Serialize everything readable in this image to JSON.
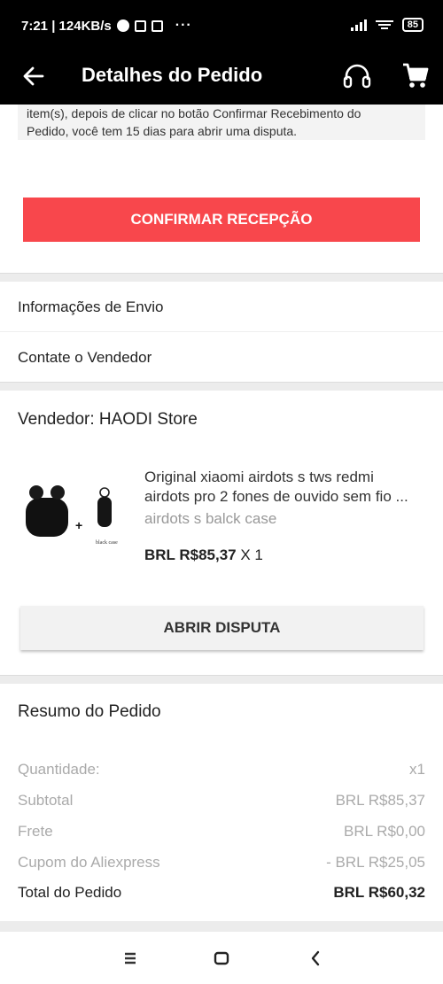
{
  "status_bar": {
    "time_speed": "7:21 | 124KB/s",
    "more": "···",
    "battery": "85"
  },
  "app_bar": {
    "title": "Detalhes do Pedido",
    "back_icon": "arrow-left-icon",
    "support_icon": "headset-icon",
    "cart_icon": "cart-icon"
  },
  "notice": {
    "line1": "item(s), depois de clicar no botão Confirmar Recebimento do",
    "line2": "Pedido, você tem 15 dias para abrir uma disputa."
  },
  "actions": {
    "confirm_label": "CONFIRMAR RECEPÇÃO",
    "dispute_label": "ABRIR DISPUTA"
  },
  "links": {
    "shipping_info": "Informações de Envio",
    "contact_seller": "Contate o Vendedor"
  },
  "seller": {
    "label": "Vendedor: HAODI Store"
  },
  "product": {
    "title_line1": "Original xiaomi airdots s tws redmi",
    "title_line2": "airdots pro 2 fones de ouvido sem fio ...",
    "variant": "airdots s balck case",
    "price": "BRL R$85,37",
    "quantity": "X 1",
    "image_caption": "black case"
  },
  "summary": {
    "title": "Resumo do Pedido",
    "rows": [
      {
        "label": "Quantidade:",
        "value": "x1"
      },
      {
        "label": "Subtotal",
        "value": "BRL R$85,37"
      },
      {
        "label": "Frete",
        "value": "BRL R$0,00"
      },
      {
        "label": "Cupom do Aliexpress",
        "value": "- BRL R$25,05"
      }
    ],
    "total_label": "Total do Pedido",
    "total_value": "BRL R$60,32"
  },
  "colors": {
    "accent": "#f8474c",
    "app_bar": "#000000"
  }
}
